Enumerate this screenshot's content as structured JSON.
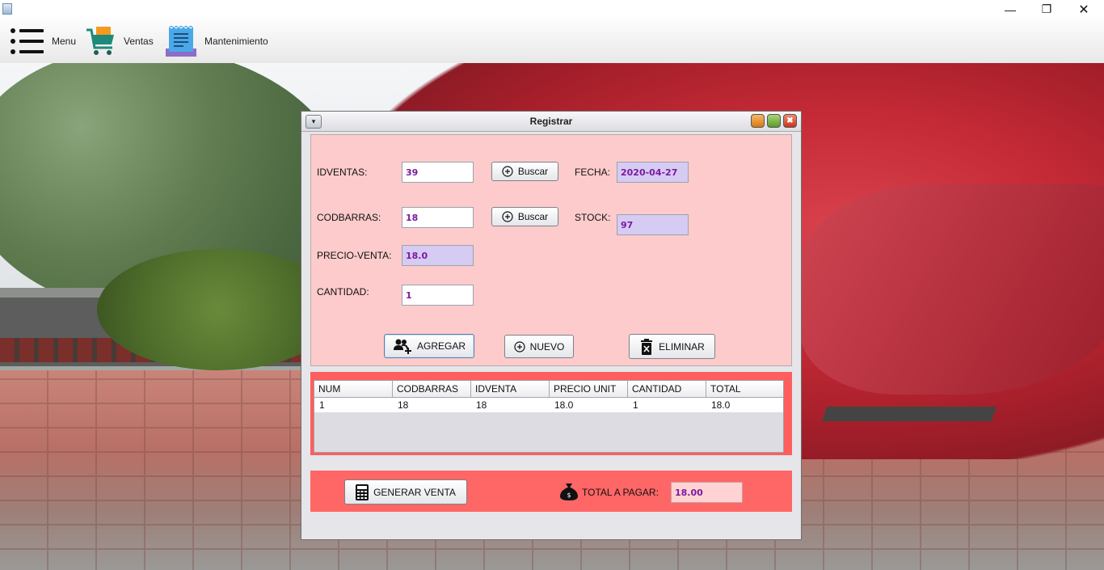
{
  "window": {
    "minimize_glyph": "—",
    "maximize_glyph": "❐",
    "close_glyph": "✕"
  },
  "menubar": {
    "menu_label": "Menu",
    "ventas_label": "Ventas",
    "mantenimiento_label": "Mantenimiento"
  },
  "dialog": {
    "title": "Registrar",
    "system_menu_glyph": "▾",
    "close_glyph": "✖"
  },
  "form": {
    "idventas_label": "IDVENTAS:",
    "idventas_value": "39",
    "codbarras_label": "CODBARRAS:",
    "codbarras_value": "18",
    "precio_label": "PRECIO-VENTA:",
    "precio_value": "18.0",
    "cantidad_label": "CANTIDAD:",
    "cantidad_value": "1",
    "fecha_label": "FECHA:",
    "fecha_value": "2020-04-27",
    "stock_label": "STOCK:",
    "stock_value": "97",
    "buscar1_label": "Buscar",
    "buscar2_label": "Buscar",
    "agregar_label": "AGREGAR",
    "nuevo_label": "NUEVO",
    "eliminar_label": "ELIMINAR"
  },
  "table": {
    "columns": [
      "NUM",
      "CODBARRAS",
      "IDVENTA",
      "PRECIO UNIT",
      "CANTIDAD",
      "TOTAL"
    ],
    "rows": [
      [
        "1",
        "18",
        "18",
        "18.0",
        "1",
        "18.0"
      ]
    ]
  },
  "footer": {
    "generar_label": "GENERAR VENTA",
    "total_label": "TOTAL A PAGAR:",
    "total_value": "18.00"
  },
  "colors": {
    "form_panel": "#fdcbcb",
    "table_panel": "#ff5e5e",
    "footer_panel": "#ff6666",
    "value_text": "#7a1aa0"
  }
}
